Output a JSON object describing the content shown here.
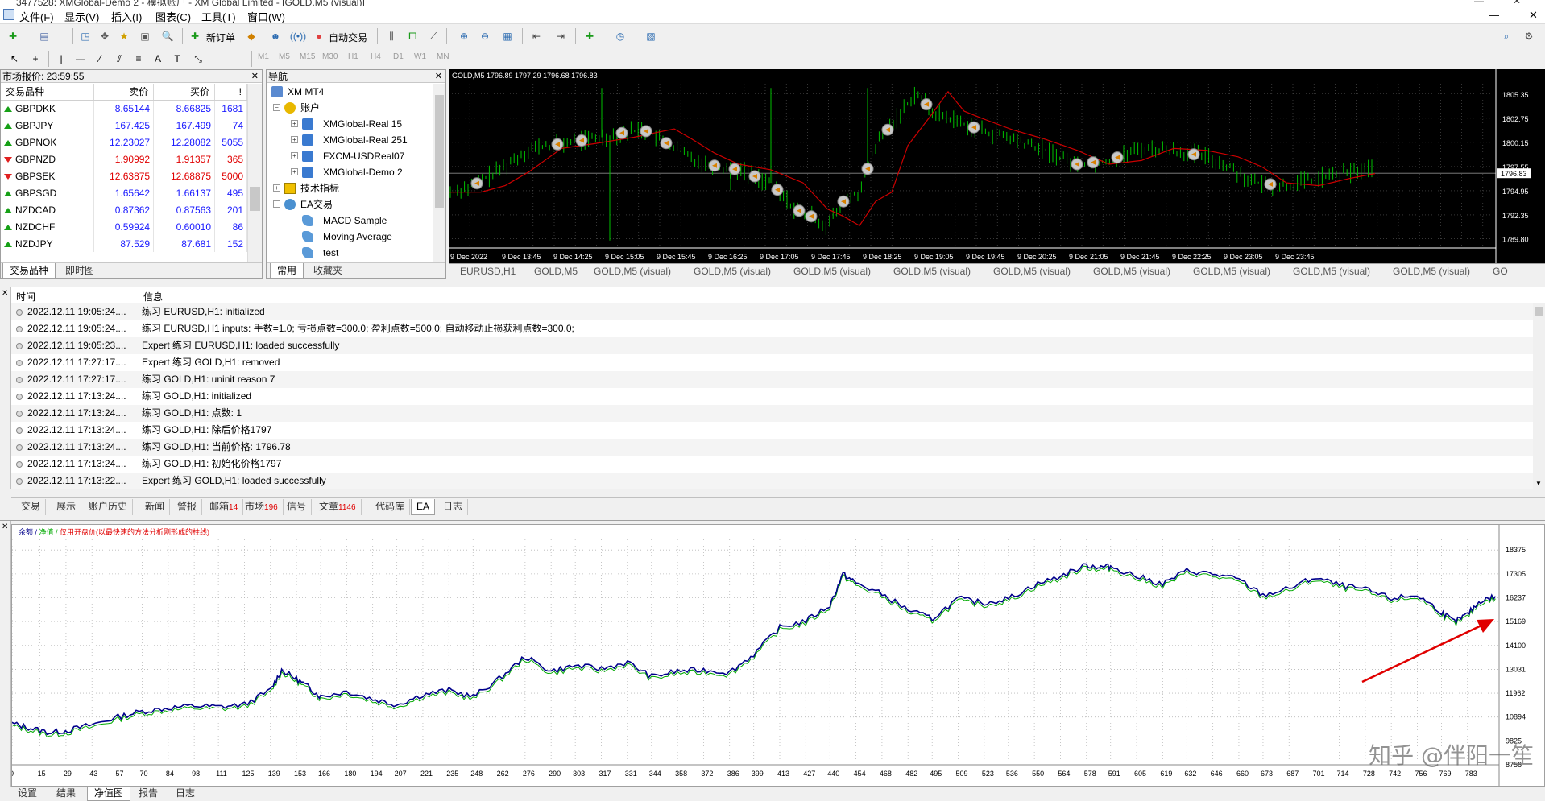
{
  "window": {
    "title": "3477528: XMGlobal-Demo 2 - 模拟账户 - XM Global Limited - [GOLD,M5 (visual)]"
  },
  "menu": [
    "文件(F)",
    "显示(V)",
    "插入(I)",
    "图表(C)",
    "工具(T)",
    "窗口(W)"
  ],
  "toolbar": {
    "new_order": "新订单",
    "auto_trade": "自动交易",
    "timeframes": [
      "M1",
      "M5",
      "M15",
      "M30",
      "H1",
      "H4",
      "D1",
      "W1",
      "MN"
    ]
  },
  "market_watch": {
    "title": "市场报价: 23:59:55",
    "columns": [
      "交易品种",
      "卖价",
      "买价",
      "!"
    ],
    "rows": [
      {
        "symbol": "GBPDKK",
        "bid": "8.65144",
        "ask": "8.66825",
        "spread": "1681",
        "dir": "up"
      },
      {
        "symbol": "GBPJPY",
        "bid": "167.425",
        "ask": "167.499",
        "spread": "74",
        "dir": "up"
      },
      {
        "symbol": "GBPNOK",
        "bid": "12.23027",
        "ask": "12.28082",
        "spread": "5055",
        "dir": "up"
      },
      {
        "symbol": "GBPNZD",
        "bid": "1.90992",
        "ask": "1.91357",
        "spread": "365",
        "dir": "down"
      },
      {
        "symbol": "GBPSEK",
        "bid": "12.63875",
        "ask": "12.68875",
        "spread": "5000",
        "dir": "down"
      },
      {
        "symbol": "GBPSGD",
        "bid": "1.65642",
        "ask": "1.66137",
        "spread": "495",
        "dir": "up"
      },
      {
        "symbol": "NZDCAD",
        "bid": "0.87362",
        "ask": "0.87563",
        "spread": "201",
        "dir": "up"
      },
      {
        "symbol": "NZDCHF",
        "bid": "0.59924",
        "ask": "0.60010",
        "spread": "86",
        "dir": "up"
      },
      {
        "symbol": "NZDJPY",
        "bid": "87.529",
        "ask": "87.681",
        "spread": "152",
        "dir": "up"
      }
    ],
    "tabs": [
      "交易品种",
      "即时图"
    ]
  },
  "navigator": {
    "title": "导航",
    "root": "XM MT4",
    "accounts_label": "账户",
    "accounts": [
      "XMGlobal-Real 15",
      "XMGlobal-Real 251",
      "FXCM-USDReal07",
      "XMGlobal-Demo 2"
    ],
    "indicators_label": "技术指标",
    "experts_label": "EA交易",
    "experts": [
      "MACD Sample",
      "Moving Average",
      "test"
    ],
    "tabs": [
      "常用",
      "收藏夹"
    ]
  },
  "chart": {
    "header": "GOLD,M5  1796.89 1797.29 1796.68 1796.83",
    "current_price": "1796.83",
    "price_labels": [
      "1805.35",
      "1802.75",
      "1800.15",
      "1797.55",
      "1794.95",
      "1792.35",
      "1789.80"
    ],
    "time_labels": [
      "9 Dec 2022",
      "9 Dec 13:45",
      "9 Dec 14:25",
      "9 Dec 15:05",
      "9 Dec 15:45",
      "9 Dec 16:25",
      "9 Dec 17:05",
      "9 Dec 17:45",
      "9 Dec 18:25",
      "9 Dec 19:05",
      "9 Dec 19:45",
      "9 Dec 20:25",
      "9 Dec 21:05",
      "9 Dec 21:45",
      "9 Dec 22:25",
      "9 Dec 23:05",
      "9 Dec 23:45"
    ],
    "tabs": [
      "EURUSD,H1",
      "GOLD,M5",
      "GOLD,M5 (visual)",
      "GOLD,M5 (visual)",
      "GOLD,M5 (visual)",
      "GOLD,M5 (visual)",
      "GOLD,M5 (visual)",
      "GOLD,M5 (visual)",
      "GOLD,M5 (visual)",
      "GOLD,M5 (visual)",
      "GOLD,M5 (visual)",
      "GO"
    ]
  },
  "terminal": {
    "col_time": "时间",
    "col_msg": "信息",
    "rows": [
      {
        "time": "2022.12.11 19:05:24....",
        "msg": "练习 EURUSD,H1: initialized"
      },
      {
        "time": "2022.12.11 19:05:24....",
        "msg": "练习 EURUSD,H1 inputs: 手数=1.0; 亏损点数=300.0; 盈利点数=500.0; 自动移动止损获利点数=300.0;"
      },
      {
        "time": "2022.12.11 19:05:23....",
        "msg": "Expert 练习 EURUSD,H1: loaded successfully"
      },
      {
        "time": "2022.12.11 17:27:17....",
        "msg": "Expert 练习 GOLD,H1: removed"
      },
      {
        "time": "2022.12.11 17:27:17....",
        "msg": "练习 GOLD,H1: uninit reason 7"
      },
      {
        "time": "2022.12.11 17:13:24....",
        "msg": "练习 GOLD,H1: initialized"
      },
      {
        "time": "2022.12.11 17:13:24....",
        "msg": "练习 GOLD,H1: 点数:  1"
      },
      {
        "time": "2022.12.11 17:13:24....",
        "msg": "练习 GOLD,H1: 除后价格1797"
      },
      {
        "time": "2022.12.11 17:13:24....",
        "msg": "练习 GOLD,H1: 当前价格:   1796.78"
      },
      {
        "time": "2022.12.11 17:13:24....",
        "msg": "练习 GOLD,H1: 初始化价格1797"
      },
      {
        "time": "2022.12.11 17:13:22....",
        "msg": "Expert 练习 GOLD,H1: loaded successfully"
      }
    ],
    "tabs": [
      {
        "label": "交易",
        "count": ""
      },
      {
        "label": "展示",
        "count": ""
      },
      {
        "label": "账户历史",
        "count": ""
      },
      {
        "label": "新闻",
        "count": ""
      },
      {
        "label": "警报",
        "count": ""
      },
      {
        "label": "邮箱",
        "count": "14"
      },
      {
        "label": "市场",
        "count": "196"
      },
      {
        "label": "信号",
        "count": ""
      },
      {
        "label": "文章",
        "count": "1146"
      },
      {
        "label": "代码库",
        "count": ""
      },
      {
        "label": "EA",
        "count": ""
      },
      {
        "label": "日志",
        "count": ""
      }
    ]
  },
  "tester": {
    "legend_balance": "余额",
    "legend_equity": "净值",
    "legend_note": "仅用开盘价(以最快速的方法分析刚形成的柱线)",
    "tabs": [
      "设置",
      "结果",
      "净值图",
      "报告",
      "日志"
    ],
    "watermark": "知乎 @伴阳一笙"
  },
  "chart_data": {
    "type": "line",
    "title": "",
    "xlabel": "",
    "ylabel": "",
    "y_ticks": [
      "18375",
      "17305",
      "16237",
      "15169",
      "14100",
      "13031",
      "11962",
      "10894",
      "9825",
      "8756"
    ],
    "x_ticks": [
      "0",
      "15",
      "29",
      "43",
      "57",
      "70",
      "84",
      "98",
      "111",
      "125",
      "139",
      "153",
      "166",
      "180",
      "194",
      "207",
      "221",
      "235",
      "248",
      "262",
      "276",
      "290",
      "303",
      "317",
      "331",
      "344",
      "358",
      "372",
      "386",
      "399",
      "413",
      "427",
      "440",
      "454",
      "468",
      "482",
      "495",
      "509",
      "523",
      "536",
      "550",
      "564",
      "578",
      "591",
      "605",
      "619",
      "632",
      "646",
      "660",
      "673",
      "687",
      "701",
      "714",
      "728",
      "742",
      "756",
      "769",
      "783"
    ],
    "ylim": [
      8756,
      18850
    ],
    "xlim": [
      0,
      800
    ],
    "series": [
      {
        "name": "余额",
        "color": "#00008b",
        "x": [
          0,
          10,
          20,
          30,
          43,
          57,
          70,
          84,
          98,
          111,
          125,
          139,
          145,
          153,
          160,
          166,
          180,
          194,
          207,
          221,
          235,
          248,
          262,
          276,
          290,
          303,
          317,
          331,
          344,
          358,
          372,
          386,
          399,
          413,
          427,
          440,
          447,
          454,
          468,
          482,
          495,
          509,
          523,
          536,
          550,
          564,
          578,
          585,
          591,
          605,
          619,
          632,
          646,
          660,
          673,
          687,
          701,
          714,
          728,
          742,
          756,
          769,
          776,
          783,
          790,
          798
        ],
        "values": [
          10600,
          10400,
          10200,
          10300,
          10550,
          10900,
          11150,
          11300,
          11400,
          11350,
          11450,
          12100,
          13000,
          12600,
          12200,
          11800,
          12050,
          11700,
          11450,
          11900,
          12100,
          11800,
          12600,
          13600,
          12950,
          13200,
          13050,
          13350,
          12700,
          12950,
          13000,
          12900,
          13700,
          14900,
          15200,
          15900,
          17300,
          16900,
          16400,
          15700,
          15300,
          16200,
          16000,
          16200,
          16800,
          17200,
          17700,
          17600,
          17650,
          17200,
          16850,
          17450,
          17300,
          17050,
          16350,
          16650,
          17150,
          16800,
          16600,
          16200,
          16350,
          15600,
          15150,
          15500,
          16100,
          16300
        ]
      }
    ]
  },
  "colors": {
    "chart_bg": "#000000",
    "candle": "#00c000",
    "ma": "#cc0000",
    "balance": "#00008b",
    "equity": "#00aa00",
    "annotation_arrow": "#e00000"
  }
}
